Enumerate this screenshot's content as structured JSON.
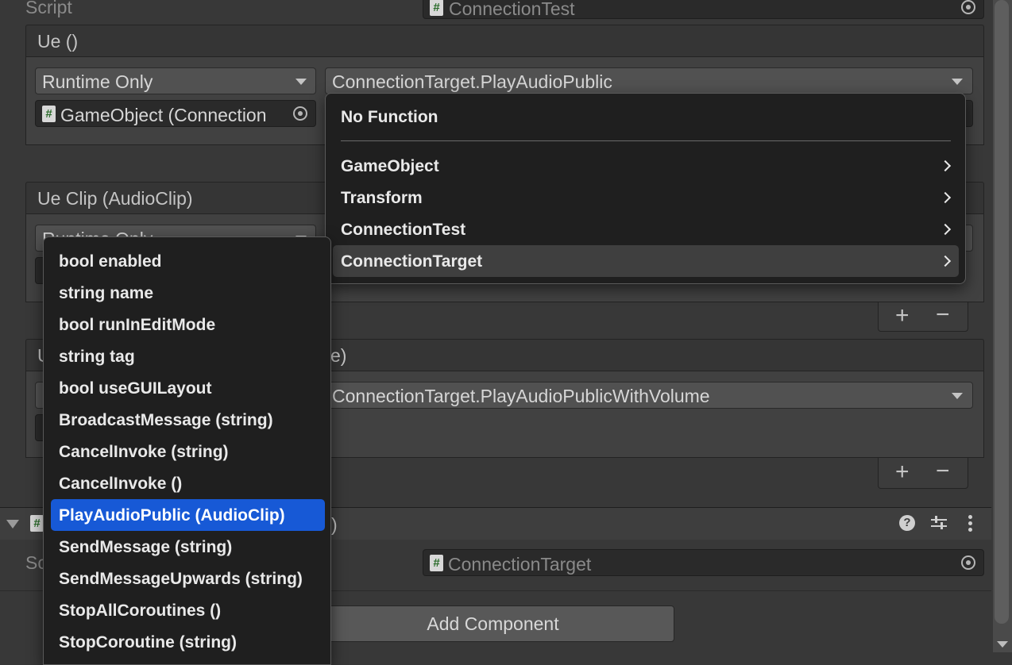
{
  "script_row": {
    "label": "Script",
    "value": "ConnectionTest"
  },
  "event1": {
    "header": "Ue ()",
    "runtime": "Runtime Only",
    "function": "ConnectionTarget.PlayAudioPublic",
    "object": "GameObject (Connection"
  },
  "event2": {
    "header": "Ue Clip (AudioClip)",
    "runtime": "Runtime Only"
  },
  "event3": {
    "header_start": "U",
    "header_end": "e)",
    "function": "ConnectionTarget.PlayAudioPublicWithVolume"
  },
  "component2": {
    "title_end": ")",
    "script_label": "Sc",
    "script_value": "ConnectionTarget"
  },
  "add_component": "Add Component",
  "plus": "+",
  "minus": "−",
  "hash": "#",
  "function_menu": {
    "no_function": "No Function",
    "items": [
      {
        "label": "GameObject"
      },
      {
        "label": "Transform"
      },
      {
        "label": "ConnectionTest"
      },
      {
        "label": "ConnectionTarget"
      }
    ]
  },
  "submenu": {
    "items": [
      "bool enabled",
      "string name",
      "bool runInEditMode",
      "string tag",
      "bool useGUILayout",
      "BroadcastMessage (string)",
      "CancelInvoke (string)",
      "CancelInvoke ()",
      "PlayAudioPublic (AudioClip)",
      "SendMessage (string)",
      "SendMessageUpwards (string)",
      "StopAllCoroutines ()",
      "StopCoroutine (string)"
    ],
    "highlighted": "PlayAudioPublic (AudioClip)"
  },
  "colors": {
    "highlight": "#1759d6",
    "background": "#383838",
    "menu": "#1f1f1f"
  }
}
